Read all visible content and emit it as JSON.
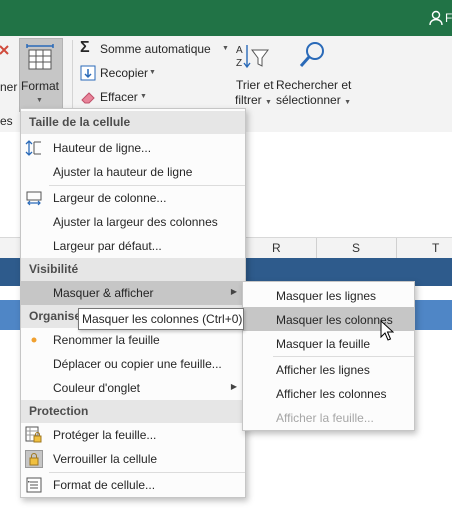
{
  "titlebar": {
    "user_initial": "F"
  },
  "ribbon": {
    "left_partial_1": "ner",
    "left_partial_2": "es",
    "format_label": "Format",
    "autosum_label": "Somme automatique",
    "fill_label": "Recopier",
    "clear_label": "Effacer",
    "sort_label_1": "Trier et",
    "sort_label_2": "filtrer",
    "find_label_1": "Rechercher et",
    "find_label_2": "sélectionner"
  },
  "sheet": {
    "columns": [
      "R",
      "S",
      "T"
    ]
  },
  "menu": {
    "section_cell_size": "Taille de la cellule",
    "row_height": "Hauteur de ligne...",
    "autofit_row_height": "Ajuster la hauteur de ligne",
    "column_width": "Largeur de colonne...",
    "autofit_column_width": "Ajuster la largeur des colonnes",
    "default_width": "Largeur par défaut...",
    "section_visibility": "Visibilité",
    "hide_unhide": "Masquer & afficher",
    "section_organize": "Organise",
    "rename_sheet": "Renommer la feuille",
    "move_copy_sheet": "Déplacer ou copier une feuille...",
    "tab_color": "Couleur d'onglet",
    "section_protection": "Protection",
    "protect_sheet": "Protéger la feuille...",
    "lock_cell": "Verrouiller la cellule",
    "format_cells": "Format de cellule..."
  },
  "submenu": {
    "hide_rows": "Masquer les lignes",
    "hide_columns": "Masquer les colonnes",
    "hide_sheet": "Masquer la feuille",
    "unhide_rows": "Afficher les lignes",
    "unhide_columns": "Afficher les colonnes",
    "unhide_sheet": "Afficher la feuille..."
  },
  "tooltip": {
    "text": "Masquer les colonnes (Ctrl+0)"
  },
  "colors": {
    "excel_green": "#217346",
    "highlight": "#c6c6c6",
    "sheet_blue": "#2e5b8c"
  }
}
